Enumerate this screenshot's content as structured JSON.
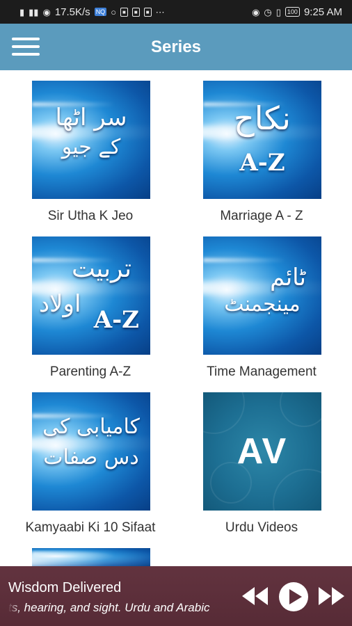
{
  "status_bar": {
    "network_speed": "17.5K/s",
    "nq_badge": "NQ",
    "battery": "100",
    "time": "9:25 AM"
  },
  "app_bar": {
    "title": "Series"
  },
  "series": [
    {
      "label": "Sir Utha K Jeo",
      "art": "blue",
      "urdu_line1": "سر اٹھا",
      "urdu_line2": "کے جیو",
      "az": ""
    },
    {
      "label": "Marriage A - Z",
      "art": "blue",
      "urdu_line1": "نکاح",
      "urdu_line2": "",
      "az": "A-Z"
    },
    {
      "label": "Parenting A-Z",
      "art": "blue",
      "urdu_line1": "تربیت",
      "urdu_line2": "اولاد",
      "az": "A-Z"
    },
    {
      "label": "Time Management",
      "art": "blue",
      "urdu_line1": "ٹائم",
      "urdu_line2": "مینجمنٹ",
      "az": ""
    },
    {
      "label": "Kamyaabi Ki 10 Sifaat",
      "art": "blue",
      "urdu_line1": "کامیابی کی",
      "urdu_line2": "دس صفات",
      "az": ""
    },
    {
      "label": "Urdu Videos",
      "art": "teal",
      "urdu_line1": "",
      "urdu_line2": "",
      "az": "AV"
    }
  ],
  "player": {
    "title": "Wisdom Delivered",
    "subtitle": "ts, hearing, and sight.  Urdu and Arabic"
  },
  "icons": {
    "menu": "hamburger-icon",
    "rewind": "rewind-icon",
    "play": "play-icon",
    "fast_forward": "fast-forward-icon"
  },
  "colors": {
    "app_bar": "#5b9bbd",
    "status_bar": "#1c1c1c",
    "player": "#5d2f3b"
  }
}
